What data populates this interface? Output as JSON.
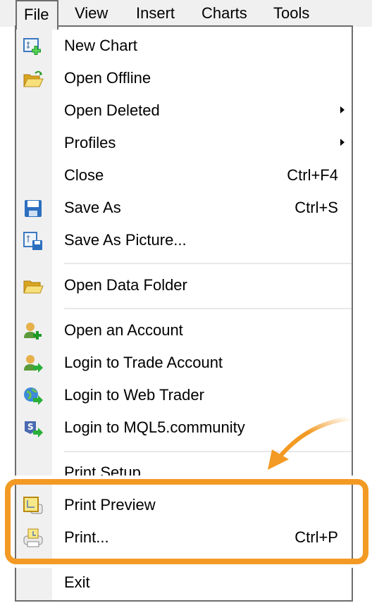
{
  "menubar": {
    "items": [
      "File",
      "View",
      "Insert",
      "Charts",
      "Tools"
    ]
  },
  "file_menu": {
    "items": [
      {
        "label": "New Chart",
        "icon": "new-chart-icon",
        "shortcut": ""
      },
      {
        "label": "Open Offline",
        "icon": "open-folder-icon",
        "shortcut": ""
      },
      {
        "label": "Open Deleted",
        "submenu": true
      },
      {
        "label": "Profiles",
        "submenu": true
      },
      {
        "label": "Close",
        "shortcut": "Ctrl+F4"
      },
      {
        "label": "Save As",
        "icon": "save-icon",
        "shortcut": "Ctrl+S"
      },
      {
        "label": "Save As Picture...",
        "icon": "save-picture-icon"
      },
      {
        "label": "Open Data Folder",
        "icon": "folder-icon"
      },
      {
        "label": "Open an Account",
        "icon": "user-add-icon"
      },
      {
        "label": "Login to Trade Account",
        "icon": "user-login-icon"
      },
      {
        "label": "Login to Web Trader",
        "icon": "globe-login-icon"
      },
      {
        "label": "Login to MQL5.community",
        "icon": "mql5-login-icon"
      },
      {
        "label": "Print Setup"
      },
      {
        "label": "Print Preview",
        "icon": "print-preview-icon"
      },
      {
        "label": "Print...",
        "icon": "printer-icon",
        "shortcut": "Ctrl+P"
      },
      {
        "label": "Exit"
      }
    ]
  },
  "highlight": {
    "color": "#f39a24",
    "targets": [
      "Print Preview",
      "Print..."
    ]
  }
}
